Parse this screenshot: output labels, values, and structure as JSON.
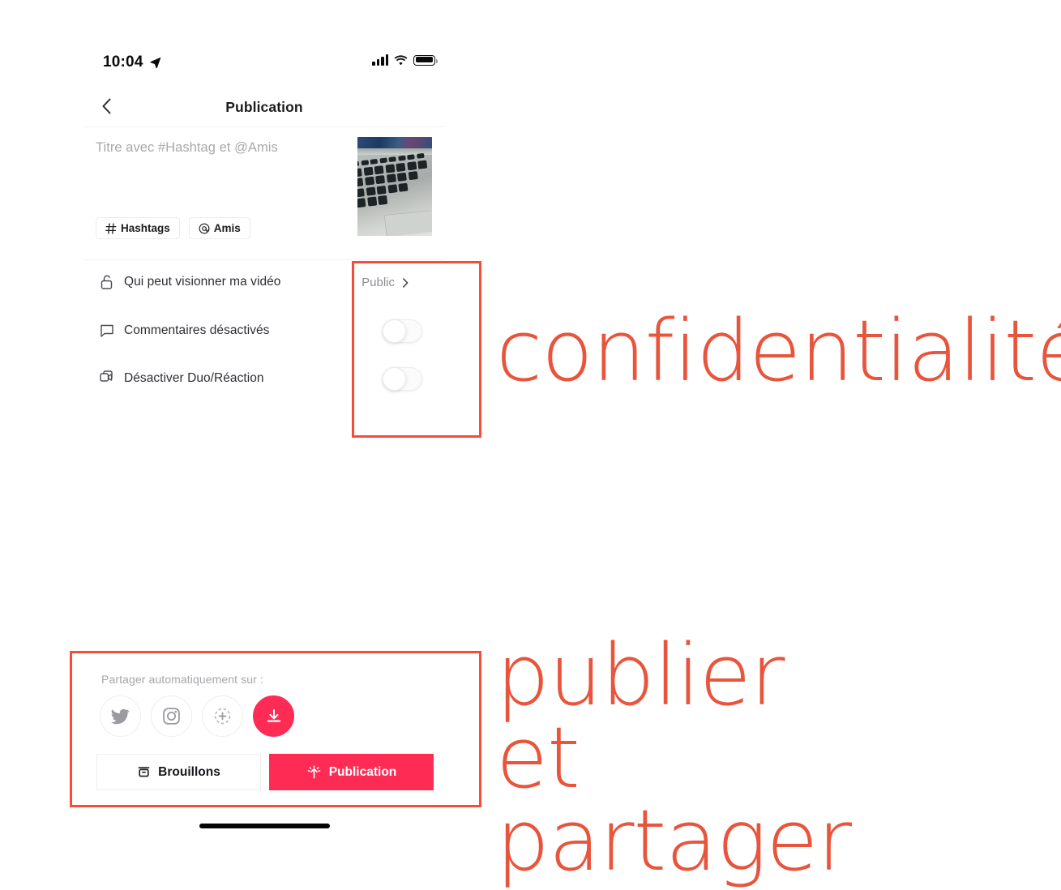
{
  "status_bar": {
    "time": "10:04",
    "location_icon": "location-arrow-icon",
    "signal_icon": "cellular-signal-icon",
    "wifi_icon": "wifi-icon",
    "battery_icon": "battery-full-icon"
  },
  "header": {
    "back_icon": "chevron-left-icon",
    "title": "Publication"
  },
  "caption": {
    "placeholder": "Titre avec #Hashtag et @Amis",
    "value": "",
    "thumbnail_alt": "laptop-keyboard-photo"
  },
  "pills": [
    {
      "icon": "hashtag-icon",
      "label": "Hashtags"
    },
    {
      "icon": "at-mention-icon",
      "label": "Amis"
    }
  ],
  "options": [
    {
      "icon": "unlock-icon",
      "label": "Qui peut visionner ma vidéo",
      "control": "select",
      "value": "Public",
      "chevron": "chevron-right-icon"
    },
    {
      "icon": "comment-bubble-icon",
      "label": "Commentaires désactivés",
      "control": "toggle",
      "value": "off"
    },
    {
      "icon": "duo-reaction-icon",
      "label": "Désactiver Duo/Réaction",
      "control": "toggle",
      "value": "off"
    }
  ],
  "share": {
    "label": "Partager automatiquement sur :",
    "targets": [
      {
        "icon": "twitter-icon",
        "name": "Twitter",
        "active": false
      },
      {
        "icon": "instagram-icon",
        "name": "Instagram",
        "active": false
      },
      {
        "icon": "add-more-icon",
        "name": "Plus",
        "active": false
      },
      {
        "icon": "download-icon",
        "name": "Télécharger",
        "active": true
      }
    ]
  },
  "actions": {
    "draft": {
      "icon": "drafts-box-icon",
      "label": "Brouillons"
    },
    "publish": {
      "icon": "publish-arrow-icon",
      "label": "Publication"
    }
  },
  "annotations": [
    {
      "text": "confidentialité",
      "target": "privacy-controls"
    },
    {
      "text": "publier et partager",
      "target": "publish-share-block"
    }
  ],
  "colors": {
    "brand_red": "#FE2C55",
    "annotation_red": "#FA4B38",
    "annotation_text": "#E8553C",
    "placeholder_gray": "#A9A9AD",
    "label_dark": "#2E2E35"
  }
}
